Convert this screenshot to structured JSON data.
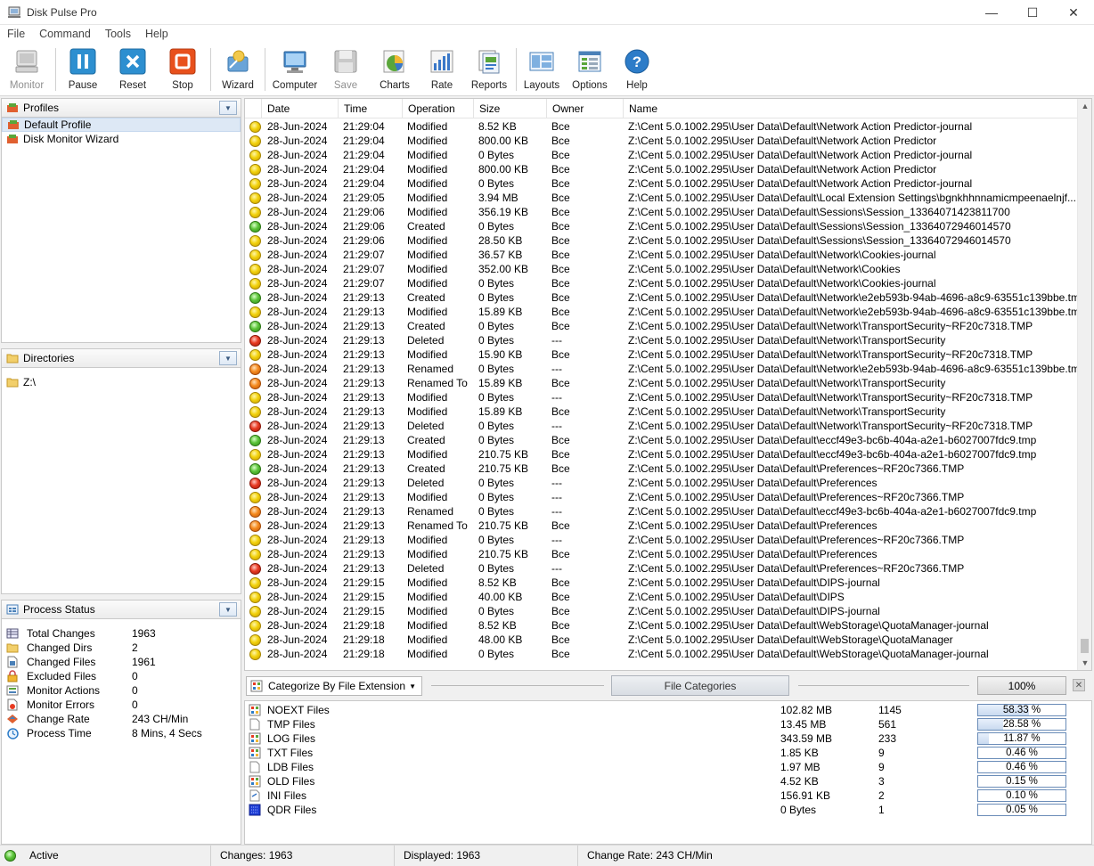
{
  "window": {
    "title": "Disk Pulse Pro"
  },
  "menu": [
    "File",
    "Command",
    "Tools",
    "Help"
  ],
  "toolbar": {
    "monitor": "Monitor",
    "pause": "Pause",
    "reset": "Reset",
    "stop": "Stop",
    "wizard": "Wizard",
    "computer": "Computer",
    "save": "Save",
    "charts": "Charts",
    "rate": "Rate",
    "reports": "Reports",
    "layouts": "Layouts",
    "options": "Options",
    "help": "Help"
  },
  "profiles": {
    "title": "Profiles",
    "items": [
      "Default Profile",
      "Disk Monitor Wizard"
    ]
  },
  "directories": {
    "title": "Directories",
    "items": [
      "Z:\\"
    ]
  },
  "process_status": {
    "title": "Process Status",
    "rows": [
      {
        "label": "Total Changes",
        "value": "1963"
      },
      {
        "label": "Changed Dirs",
        "value": "2"
      },
      {
        "label": "Changed Files",
        "value": "1961"
      },
      {
        "label": "Excluded Files",
        "value": "0"
      },
      {
        "label": "Monitor Actions",
        "value": "0"
      },
      {
        "label": "Monitor Errors",
        "value": "0"
      },
      {
        "label": "Change Rate",
        "value": "243 CH/Min"
      },
      {
        "label": "Process Time",
        "value": "8 Mins, 4 Secs"
      }
    ]
  },
  "columns": [
    "Date",
    "Time",
    "Operation",
    "Size",
    "Owner",
    "Name"
  ],
  "events": [
    {
      "status": "modified",
      "date": "28-Jun-2024",
      "time": "21:29:04",
      "op": "Modified",
      "size": "8.52 KB",
      "owner": "Bce",
      "name": "Z:\\Cent 5.0.1002.295\\User Data\\Default\\Network Action Predictor-journal"
    },
    {
      "status": "modified",
      "date": "28-Jun-2024",
      "time": "21:29:04",
      "op": "Modified",
      "size": "800.00 KB",
      "owner": "Bce",
      "name": "Z:\\Cent 5.0.1002.295\\User Data\\Default\\Network Action Predictor"
    },
    {
      "status": "modified",
      "date": "28-Jun-2024",
      "time": "21:29:04",
      "op": "Modified",
      "size": "0 Bytes",
      "owner": "Bce",
      "name": "Z:\\Cent 5.0.1002.295\\User Data\\Default\\Network Action Predictor-journal"
    },
    {
      "status": "modified",
      "date": "28-Jun-2024",
      "time": "21:29:04",
      "op": "Modified",
      "size": "800.00 KB",
      "owner": "Bce",
      "name": "Z:\\Cent 5.0.1002.295\\User Data\\Default\\Network Action Predictor"
    },
    {
      "status": "modified",
      "date": "28-Jun-2024",
      "time": "21:29:04",
      "op": "Modified",
      "size": "0 Bytes",
      "owner": "Bce",
      "name": "Z:\\Cent 5.0.1002.295\\User Data\\Default\\Network Action Predictor-journal"
    },
    {
      "status": "modified",
      "date": "28-Jun-2024",
      "time": "21:29:05",
      "op": "Modified",
      "size": "3.94 MB",
      "owner": "Bce",
      "name": "Z:\\Cent 5.0.1002.295\\User Data\\Default\\Local Extension Settings\\bgnkhhnnamicmpeenaelnjf..."
    },
    {
      "status": "modified",
      "date": "28-Jun-2024",
      "time": "21:29:06",
      "op": "Modified",
      "size": "356.19 KB",
      "owner": "Bce",
      "name": "Z:\\Cent 5.0.1002.295\\User Data\\Default\\Sessions\\Session_13364071423811700"
    },
    {
      "status": "created",
      "date": "28-Jun-2024",
      "time": "21:29:06",
      "op": "Created",
      "size": "0 Bytes",
      "owner": "Bce",
      "name": "Z:\\Cent 5.0.1002.295\\User Data\\Default\\Sessions\\Session_13364072946014570"
    },
    {
      "status": "modified",
      "date": "28-Jun-2024",
      "time": "21:29:06",
      "op": "Modified",
      "size": "28.50 KB",
      "owner": "Bce",
      "name": "Z:\\Cent 5.0.1002.295\\User Data\\Default\\Sessions\\Session_13364072946014570"
    },
    {
      "status": "modified",
      "date": "28-Jun-2024",
      "time": "21:29:07",
      "op": "Modified",
      "size": "36.57 KB",
      "owner": "Bce",
      "name": "Z:\\Cent 5.0.1002.295\\User Data\\Default\\Network\\Cookies-journal"
    },
    {
      "status": "modified",
      "date": "28-Jun-2024",
      "time": "21:29:07",
      "op": "Modified",
      "size": "352.00 KB",
      "owner": "Bce",
      "name": "Z:\\Cent 5.0.1002.295\\User Data\\Default\\Network\\Cookies"
    },
    {
      "status": "modified",
      "date": "28-Jun-2024",
      "time": "21:29:07",
      "op": "Modified",
      "size": "0 Bytes",
      "owner": "Bce",
      "name": "Z:\\Cent 5.0.1002.295\\User Data\\Default\\Network\\Cookies-journal"
    },
    {
      "status": "created",
      "date": "28-Jun-2024",
      "time": "21:29:13",
      "op": "Created",
      "size": "0 Bytes",
      "owner": "Bce",
      "name": "Z:\\Cent 5.0.1002.295\\User Data\\Default\\Network\\e2eb593b-94ab-4696-a8c9-63551c139bbe.tmp"
    },
    {
      "status": "modified",
      "date": "28-Jun-2024",
      "time": "21:29:13",
      "op": "Modified",
      "size": "15.89 KB",
      "owner": "Bce",
      "name": "Z:\\Cent 5.0.1002.295\\User Data\\Default\\Network\\e2eb593b-94ab-4696-a8c9-63551c139bbe.tmp"
    },
    {
      "status": "created",
      "date": "28-Jun-2024",
      "time": "21:29:13",
      "op": "Created",
      "size": "0 Bytes",
      "owner": "Bce",
      "name": "Z:\\Cent 5.0.1002.295\\User Data\\Default\\Network\\TransportSecurity~RF20c7318.TMP"
    },
    {
      "status": "deleted",
      "date": "28-Jun-2024",
      "time": "21:29:13",
      "op": "Deleted",
      "size": "0 Bytes",
      "owner": "---",
      "name": "Z:\\Cent 5.0.1002.295\\User Data\\Default\\Network\\TransportSecurity"
    },
    {
      "status": "modified",
      "date": "28-Jun-2024",
      "time": "21:29:13",
      "op": "Modified",
      "size": "15.90 KB",
      "owner": "Bce",
      "name": "Z:\\Cent 5.0.1002.295\\User Data\\Default\\Network\\TransportSecurity~RF20c7318.TMP"
    },
    {
      "status": "renamed",
      "date": "28-Jun-2024",
      "time": "21:29:13",
      "op": "Renamed",
      "size": "0 Bytes",
      "owner": "---",
      "name": "Z:\\Cent 5.0.1002.295\\User Data\\Default\\Network\\e2eb593b-94ab-4696-a8c9-63551c139bbe.tmp"
    },
    {
      "status": "renamed",
      "date": "28-Jun-2024",
      "time": "21:29:13",
      "op": "Renamed To",
      "size": "15.89 KB",
      "owner": "Bce",
      "name": "Z:\\Cent 5.0.1002.295\\User Data\\Default\\Network\\TransportSecurity"
    },
    {
      "status": "modified",
      "date": "28-Jun-2024",
      "time": "21:29:13",
      "op": "Modified",
      "size": "0 Bytes",
      "owner": "---",
      "name": "Z:\\Cent 5.0.1002.295\\User Data\\Default\\Network\\TransportSecurity~RF20c7318.TMP"
    },
    {
      "status": "modified",
      "date": "28-Jun-2024",
      "time": "21:29:13",
      "op": "Modified",
      "size": "15.89 KB",
      "owner": "Bce",
      "name": "Z:\\Cent 5.0.1002.295\\User Data\\Default\\Network\\TransportSecurity"
    },
    {
      "status": "deleted",
      "date": "28-Jun-2024",
      "time": "21:29:13",
      "op": "Deleted",
      "size": "0 Bytes",
      "owner": "---",
      "name": "Z:\\Cent 5.0.1002.295\\User Data\\Default\\Network\\TransportSecurity~RF20c7318.TMP"
    },
    {
      "status": "created",
      "date": "28-Jun-2024",
      "time": "21:29:13",
      "op": "Created",
      "size": "0 Bytes",
      "owner": "Bce",
      "name": "Z:\\Cent 5.0.1002.295\\User Data\\Default\\eccf49e3-bc6b-404a-a2e1-b6027007fdc9.tmp"
    },
    {
      "status": "modified",
      "date": "28-Jun-2024",
      "time": "21:29:13",
      "op": "Modified",
      "size": "210.75 KB",
      "owner": "Bce",
      "name": "Z:\\Cent 5.0.1002.295\\User Data\\Default\\eccf49e3-bc6b-404a-a2e1-b6027007fdc9.tmp"
    },
    {
      "status": "created",
      "date": "28-Jun-2024",
      "time": "21:29:13",
      "op": "Created",
      "size": "210.75 KB",
      "owner": "Bce",
      "name": "Z:\\Cent 5.0.1002.295\\User Data\\Default\\Preferences~RF20c7366.TMP"
    },
    {
      "status": "deleted",
      "date": "28-Jun-2024",
      "time": "21:29:13",
      "op": "Deleted",
      "size": "0 Bytes",
      "owner": "---",
      "name": "Z:\\Cent 5.0.1002.295\\User Data\\Default\\Preferences"
    },
    {
      "status": "modified",
      "date": "28-Jun-2024",
      "time": "21:29:13",
      "op": "Modified",
      "size": "0 Bytes",
      "owner": "---",
      "name": "Z:\\Cent 5.0.1002.295\\User Data\\Default\\Preferences~RF20c7366.TMP"
    },
    {
      "status": "renamed",
      "date": "28-Jun-2024",
      "time": "21:29:13",
      "op": "Renamed",
      "size": "0 Bytes",
      "owner": "---",
      "name": "Z:\\Cent 5.0.1002.295\\User Data\\Default\\eccf49e3-bc6b-404a-a2e1-b6027007fdc9.tmp"
    },
    {
      "status": "renamed",
      "date": "28-Jun-2024",
      "time": "21:29:13",
      "op": "Renamed To",
      "size": "210.75 KB",
      "owner": "Bce",
      "name": "Z:\\Cent 5.0.1002.295\\User Data\\Default\\Preferences"
    },
    {
      "status": "modified",
      "date": "28-Jun-2024",
      "time": "21:29:13",
      "op": "Modified",
      "size": "0 Bytes",
      "owner": "---",
      "name": "Z:\\Cent 5.0.1002.295\\User Data\\Default\\Preferences~RF20c7366.TMP"
    },
    {
      "status": "modified",
      "date": "28-Jun-2024",
      "time": "21:29:13",
      "op": "Modified",
      "size": "210.75 KB",
      "owner": "Bce",
      "name": "Z:\\Cent 5.0.1002.295\\User Data\\Default\\Preferences"
    },
    {
      "status": "deleted",
      "date": "28-Jun-2024",
      "time": "21:29:13",
      "op": "Deleted",
      "size": "0 Bytes",
      "owner": "---",
      "name": "Z:\\Cent 5.0.1002.295\\User Data\\Default\\Preferences~RF20c7366.TMP"
    },
    {
      "status": "modified",
      "date": "28-Jun-2024",
      "time": "21:29:15",
      "op": "Modified",
      "size": "8.52 KB",
      "owner": "Bce",
      "name": "Z:\\Cent 5.0.1002.295\\User Data\\Default\\DIPS-journal"
    },
    {
      "status": "modified",
      "date": "28-Jun-2024",
      "time": "21:29:15",
      "op": "Modified",
      "size": "40.00 KB",
      "owner": "Bce",
      "name": "Z:\\Cent 5.0.1002.295\\User Data\\Default\\DIPS"
    },
    {
      "status": "modified",
      "date": "28-Jun-2024",
      "time": "21:29:15",
      "op": "Modified",
      "size": "0 Bytes",
      "owner": "Bce",
      "name": "Z:\\Cent 5.0.1002.295\\User Data\\Default\\DIPS-journal"
    },
    {
      "status": "modified",
      "date": "28-Jun-2024",
      "time": "21:29:18",
      "op": "Modified",
      "size": "8.52 KB",
      "owner": "Bce",
      "name": "Z:\\Cent 5.0.1002.295\\User Data\\Default\\WebStorage\\QuotaManager-journal"
    },
    {
      "status": "modified",
      "date": "28-Jun-2024",
      "time": "21:29:18",
      "op": "Modified",
      "size": "48.00 KB",
      "owner": "Bce",
      "name": "Z:\\Cent 5.0.1002.295\\User Data\\Default\\WebStorage\\QuotaManager"
    },
    {
      "status": "modified",
      "date": "28-Jun-2024",
      "time": "21:29:18",
      "op": "Modified",
      "size": "0 Bytes",
      "owner": "Bce",
      "name": "Z:\\Cent 5.0.1002.295\\User Data\\Default\\WebStorage\\QuotaManager-journal"
    }
  ],
  "categorize": {
    "select_label": "Categorize By File Extension",
    "categories_button": "File Categories",
    "percent_box": "100%"
  },
  "categories": [
    {
      "icon": "grid-file-icon",
      "name": "NOEXT Files",
      "size": "102.82 MB",
      "count": "1145",
      "pct": 58.33,
      "pct_label": "58.33 %"
    },
    {
      "icon": "blank-file-icon",
      "name": "TMP Files",
      "size": "13.45 MB",
      "count": "561",
      "pct": 28.58,
      "pct_label": "28.58 %"
    },
    {
      "icon": "grid-file-icon",
      "name": "LOG Files",
      "size": "343.59 MB",
      "count": "233",
      "pct": 11.87,
      "pct_label": "11.87 %"
    },
    {
      "icon": "grid-file-icon",
      "name": "TXT Files",
      "size": "1.85 KB",
      "count": "9",
      "pct": 0.46,
      "pct_label": "0.46 %"
    },
    {
      "icon": "blank-file-icon",
      "name": "LDB Files",
      "size": "1.97 MB",
      "count": "9",
      "pct": 0.46,
      "pct_label": "0.46 %"
    },
    {
      "icon": "grid-file-icon",
      "name": "OLD Files",
      "size": "4.52 KB",
      "count": "3",
      "pct": 0.15,
      "pct_label": "0.15 %"
    },
    {
      "icon": "ini-file-icon",
      "name": "INI Files",
      "size": "156.91 KB",
      "count": "2",
      "pct": 0.1,
      "pct_label": "0.10 %"
    },
    {
      "icon": "blue-file-icon",
      "name": "QDR Files",
      "size": "0 Bytes",
      "count": "1",
      "pct": 0.05,
      "pct_label": "0.05 %"
    }
  ],
  "statusbar": {
    "state": "Active",
    "changes": "Changes: 1963",
    "displayed": "Displayed: 1963",
    "change_rate": "Change Rate: 243 CH/Min"
  }
}
